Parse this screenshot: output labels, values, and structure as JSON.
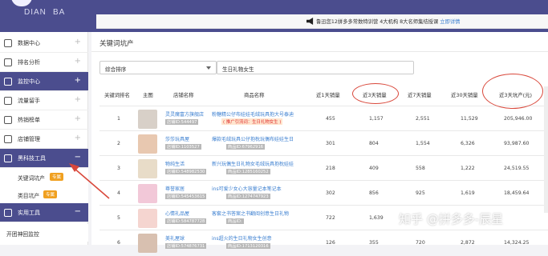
{
  "brand": {
    "line1": "DIAN",
    "line2": "BA"
  },
  "notice": {
    "text": "鲁迅您12拼多多常数特训营 4大机构 8大名师集结授课",
    "link": "立即详情"
  },
  "sidebar": {
    "items": [
      {
        "label": "数据中心",
        "icon": "chart-icon"
      },
      {
        "label": "排名分析",
        "icon": "rank-icon"
      },
      {
        "label": "监控中心",
        "icon": "monitor-icon"
      },
      {
        "label": "流量留手",
        "icon": "traffic-icon"
      },
      {
        "label": "热销榜单",
        "icon": "hot-icon"
      },
      {
        "label": "店铺管理",
        "icon": "shop-icon"
      },
      {
        "label": "黑科技工具",
        "icon": "tool-icon"
      },
      {
        "label": "实用工具",
        "icon": "wrench-icon"
      }
    ],
    "subitems": [
      {
        "label": "关键词坑产",
        "tag": "专属"
      },
      {
        "label": "类目坑产",
        "tag": "专属"
      }
    ],
    "bottom": "开团神回监控"
  },
  "main": {
    "title": "关键词坑产",
    "sort_select": "综合排序",
    "keyword_select": "生日礼物女生"
  },
  "table": {
    "headers": [
      "关键词排名",
      "主图",
      "店铺名称",
      "商品名称",
      "近1天销量",
      "近3天销量",
      "近7天销量",
      "近30天销量",
      "近3天坑产(元)"
    ],
    "rows": [
      {
        "rank": "1",
        "shop": "灵灵魔富方旗舰店",
        "shop_id": "店铺ID:544497",
        "product": "粉糖精公仔布娃娃毛绒玩具抱大号泰迪",
        "product_note": "( 推广引流词：生日礼物女生 )",
        "d1": "455",
        "d3": "1,157",
        "d7": "2,551",
        "d30": "11,529",
        "pit": "205,946.00",
        "color": "#d8d0c8"
      },
      {
        "rank": "2",
        "shop": "莎莎玩具屋",
        "shop_id": "店铺ID:1103527",
        "product": "爆款毛绒玩具公仔抱枕玩偶布娃娃生日",
        "product_id": "商品ID:67962916",
        "d1": "301",
        "d3": "804",
        "d7": "1,554",
        "d30": "6,326",
        "pit": "93,987.60",
        "color": "#e8c8b0"
      },
      {
        "rank": "3",
        "shop": "物纯生活",
        "shop_id": "店铺ID:548982530",
        "product": "新兴玩偶生日礼物女毛绒玩具抱枕娃娃",
        "product_id": "商品ID:1285160252",
        "d1": "218",
        "d3": "409",
        "d7": "558",
        "d30": "1,222",
        "pit": "24,519.55",
        "color": "#e8dcc8"
      },
      {
        "rank": "4",
        "shop": "尊誉家居",
        "shop_id": "店铺ID:545453615",
        "product": "ins可爱少女心大容量记本笔记本",
        "product_id": "商品ID:1274747923",
        "d1": "302",
        "d3": "856",
        "d7": "925",
        "d30": "1,619",
        "pit": "18,459.64",
        "color": "#f2c8d8"
      },
      {
        "rank": "5",
        "shop": "心情礼品屋",
        "shop_id": "店铺ID:584787728",
        "product": "客套之书答案之书翻阅创意生日礼物",
        "product_id": "商品ID:",
        "d1": "722",
        "d3": "1,639",
        "d7": "",
        "d30": "",
        "pit": "",
        "color": "#f5d5d0"
      },
      {
        "rank": "6",
        "shop": "美礼屋球",
        "shop_id": "店铺ID:574876731",
        "product": "ins超火的生日礼物女生创意",
        "product_id": "商品ID:1713120316",
        "d1": "126",
        "d3": "355",
        "d7": "720",
        "d30": "2,872",
        "pit": "14,324.25",
        "color": "#d8c0b0"
      }
    ]
  },
  "watermark": "知乎 @拼多多-辰星",
  "colors": {
    "nav": "#4b4d8e",
    "link": "#3b7fd0",
    "highlight_circle": "#d9483b",
    "tag": "#f0a020"
  }
}
